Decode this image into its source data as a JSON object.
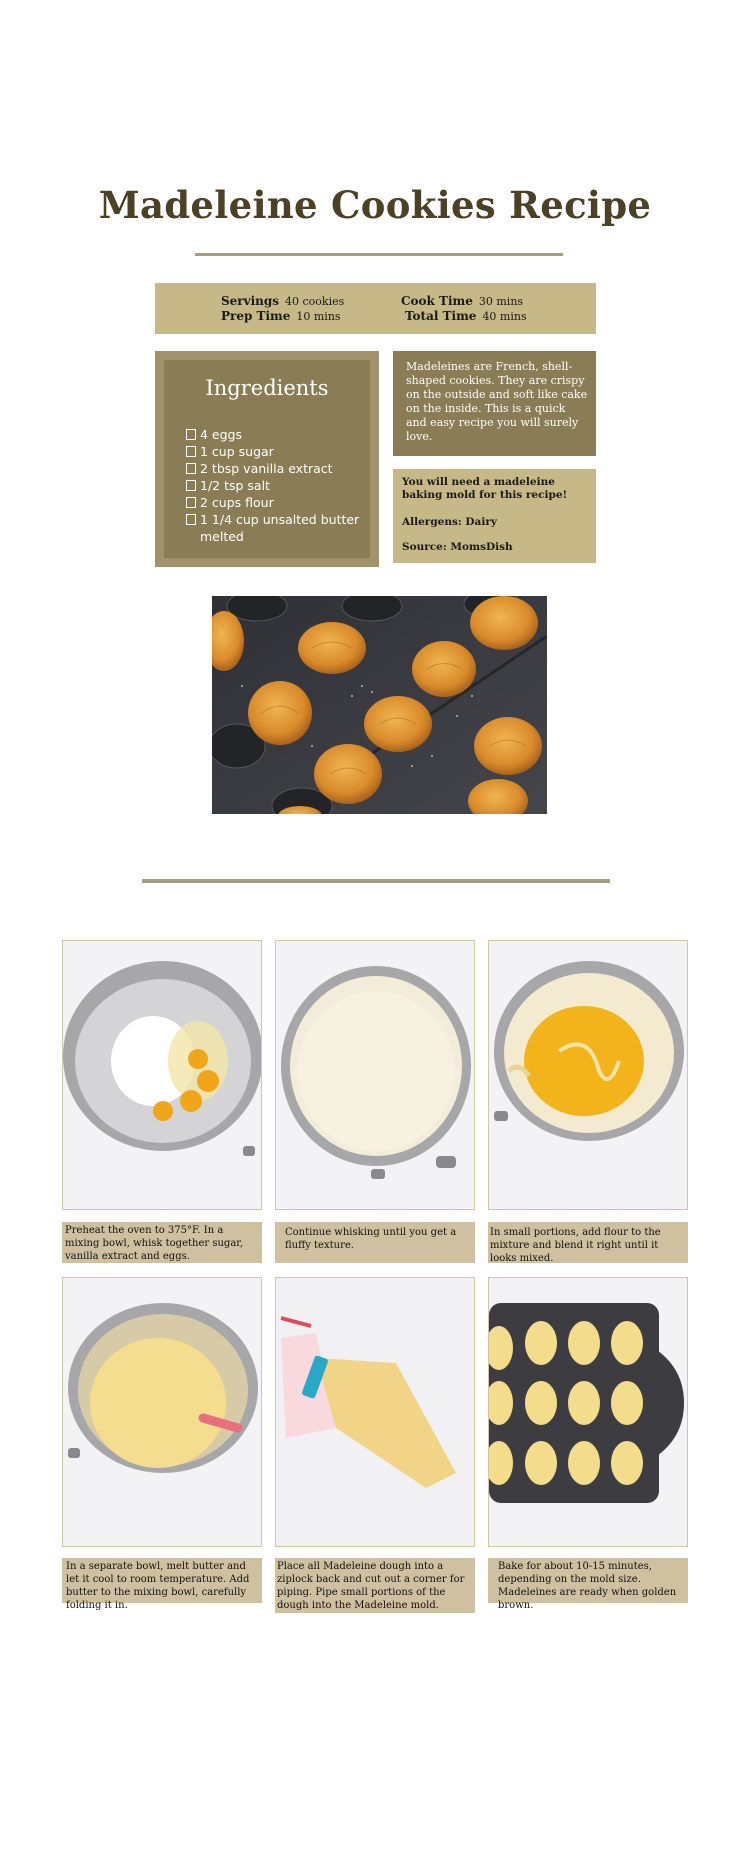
{
  "title": "Madeleine Cookies Recipe",
  "meta": {
    "servings_label": "Servings",
    "servings_value": "40 cookies",
    "prep_label": "Prep Time",
    "prep_value": "10 mins",
    "cook_label": "Cook Time",
    "cook_value": "30 mins",
    "total_label": "Total Time",
    "total_value": "40 mins"
  },
  "ingredients": {
    "title": "Ingredients",
    "items": [
      "4 eggs",
      "1 cup sugar",
      "2 tbsp vanilla extract",
      "1/2 tsp salt",
      "2 cups flour",
      "1 1/4 cup unsalted butter melted"
    ]
  },
  "description": "Madeleines are French, shell-shaped cookies. They are crispy on the outside and soft like cake on the inside. This is a quick and easy recipe you will surely love.",
  "notes": {
    "mold": "You will need a madeleine baking mold for this recipe!",
    "allergens": "Allergens: Dairy",
    "source": "Source: MomsDish"
  },
  "steps": [
    {
      "caption": "Preheat the oven to 375°F. In a mixing bowl, whisk together sugar, vanilla extract and eggs."
    },
    {
      "caption": "Continue whisking until you get a fluffy texture."
    },
    {
      "caption": "In small portions, add flour to the mixture and blend it right until it looks mixed."
    },
    {
      "caption": "In a separate bowl, melt butter and let it cool to room temperature. Add butter to the mixing bowl, carefully folding it in."
    },
    {
      "caption": "Place all Madeleine dough into a ziplock back and cut out a corner for piping. Pipe small portions of the dough into the Madeleine mold."
    },
    {
      "caption": "Bake for about 10-15 minutes, depending on the mold size. Madeleines are ready when golden brown."
    }
  ],
  "colors": {
    "heading": "#4a4126",
    "tan": "#c6b887",
    "olive": "#8a7c54",
    "caption_bg": "#cfc0a0"
  }
}
